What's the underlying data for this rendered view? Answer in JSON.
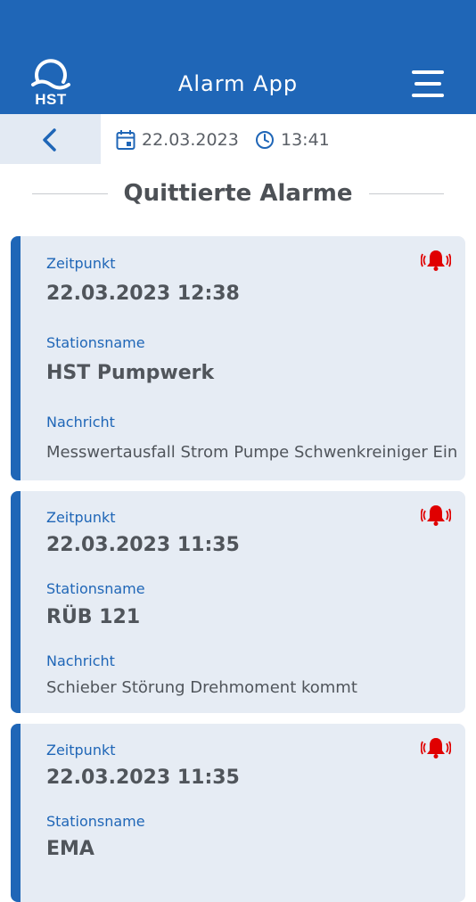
{
  "header": {
    "logo_text": "HST",
    "title": "Alarm App",
    "menu_icon": "hamburger-menu-icon"
  },
  "subbar": {
    "back_icon": "chevron-left-icon",
    "date": "22.03.2023",
    "time": "13:41"
  },
  "section_title": "Quittierte Alarme",
  "labels": {
    "time": "Zeitpunkt",
    "station": "Stationsname",
    "message": "Nachricht"
  },
  "alarms": [
    {
      "timestamp": "22.03.2023 12:38",
      "station": "HST Pumpwerk",
      "message": "Messwertausfall Strom Pumpe Schwenkreiniger Ein"
    },
    {
      "timestamp": "22.03.2023 11:35",
      "station": "RÜB 121",
      "message": "Schieber Störung Drehmoment kommt"
    },
    {
      "timestamp": "22.03.2023 11:35",
      "station": "EMA",
      "message": ""
    }
  ],
  "colors": {
    "brand": "#1f66b7",
    "card_bg": "#e6ecf4",
    "alarm_red": "#e00000"
  }
}
